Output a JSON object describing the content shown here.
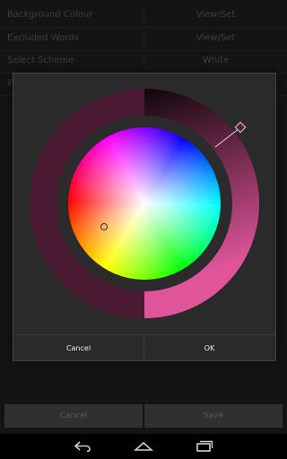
{
  "settings": {
    "rows": [
      {
        "label": "Background Colour",
        "value": "View/Set"
      },
      {
        "label": "Excluded Words",
        "value": "View/Set"
      },
      {
        "label": "Select Scheme",
        "value": "White"
      },
      {
        "label": "W",
        "value": ""
      }
    ]
  },
  "color_picker": {
    "selected_color": "#5a1f3a",
    "opacity_gradient": {
      "from": "#000000",
      "to": "#e0559a"
    },
    "value_ring_dim_color": "#4a1a32",
    "icons": [
      "saturation-value-handle-icon",
      "hue-handle-icon"
    ]
  },
  "dialog": {
    "cancel_label": "Cancel",
    "ok_label": "OK"
  },
  "actions": {
    "cancel_label": "Cancel",
    "save_label": "Save"
  },
  "navbar": {
    "icons": [
      "back-icon",
      "home-icon",
      "recent-apps-icon"
    ]
  }
}
